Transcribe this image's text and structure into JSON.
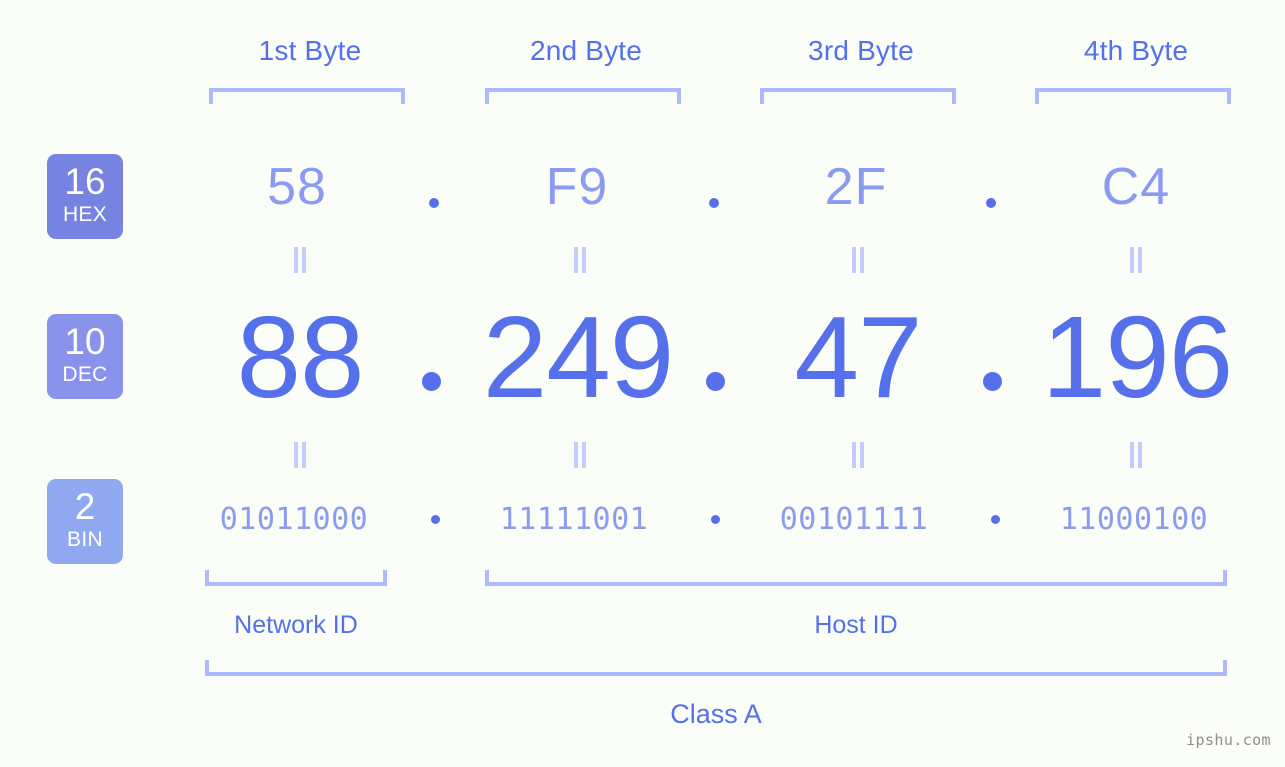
{
  "meta": {
    "background_color": "#fbfdf8",
    "accent_strong": "#5570ea",
    "accent_light": "#8b9bf0",
    "bracket_color": "#aeb9fb",
    "equals_color": "#c3ccfb",
    "watermark": "ipshu.com"
  },
  "headers": [
    {
      "label": "1st Byte"
    },
    {
      "label": "2nd Byte"
    },
    {
      "label": "3rd Byte"
    },
    {
      "label": "4th Byte"
    }
  ],
  "bases": [
    {
      "number": "16",
      "name": "HEX",
      "color": "#7683e0"
    },
    {
      "number": "10",
      "name": "DEC",
      "color": "#8a93ec"
    },
    {
      "number": "2",
      "name": "BIN",
      "color": "#8fa8f0"
    }
  ],
  "rows": {
    "hex": {
      "octets": [
        "58",
        "F9",
        "2F",
        "C4"
      ],
      "separator": "."
    },
    "dec": {
      "octets": [
        "88",
        "249",
        "47",
        "196"
      ],
      "separator": "."
    },
    "bin": {
      "octets": [
        "01011000",
        "11111001",
        "00101111",
        "11000100"
      ],
      "separator": "."
    }
  },
  "sections": {
    "network_id": "Network ID",
    "host_id": "Host ID",
    "class": "Class A"
  }
}
